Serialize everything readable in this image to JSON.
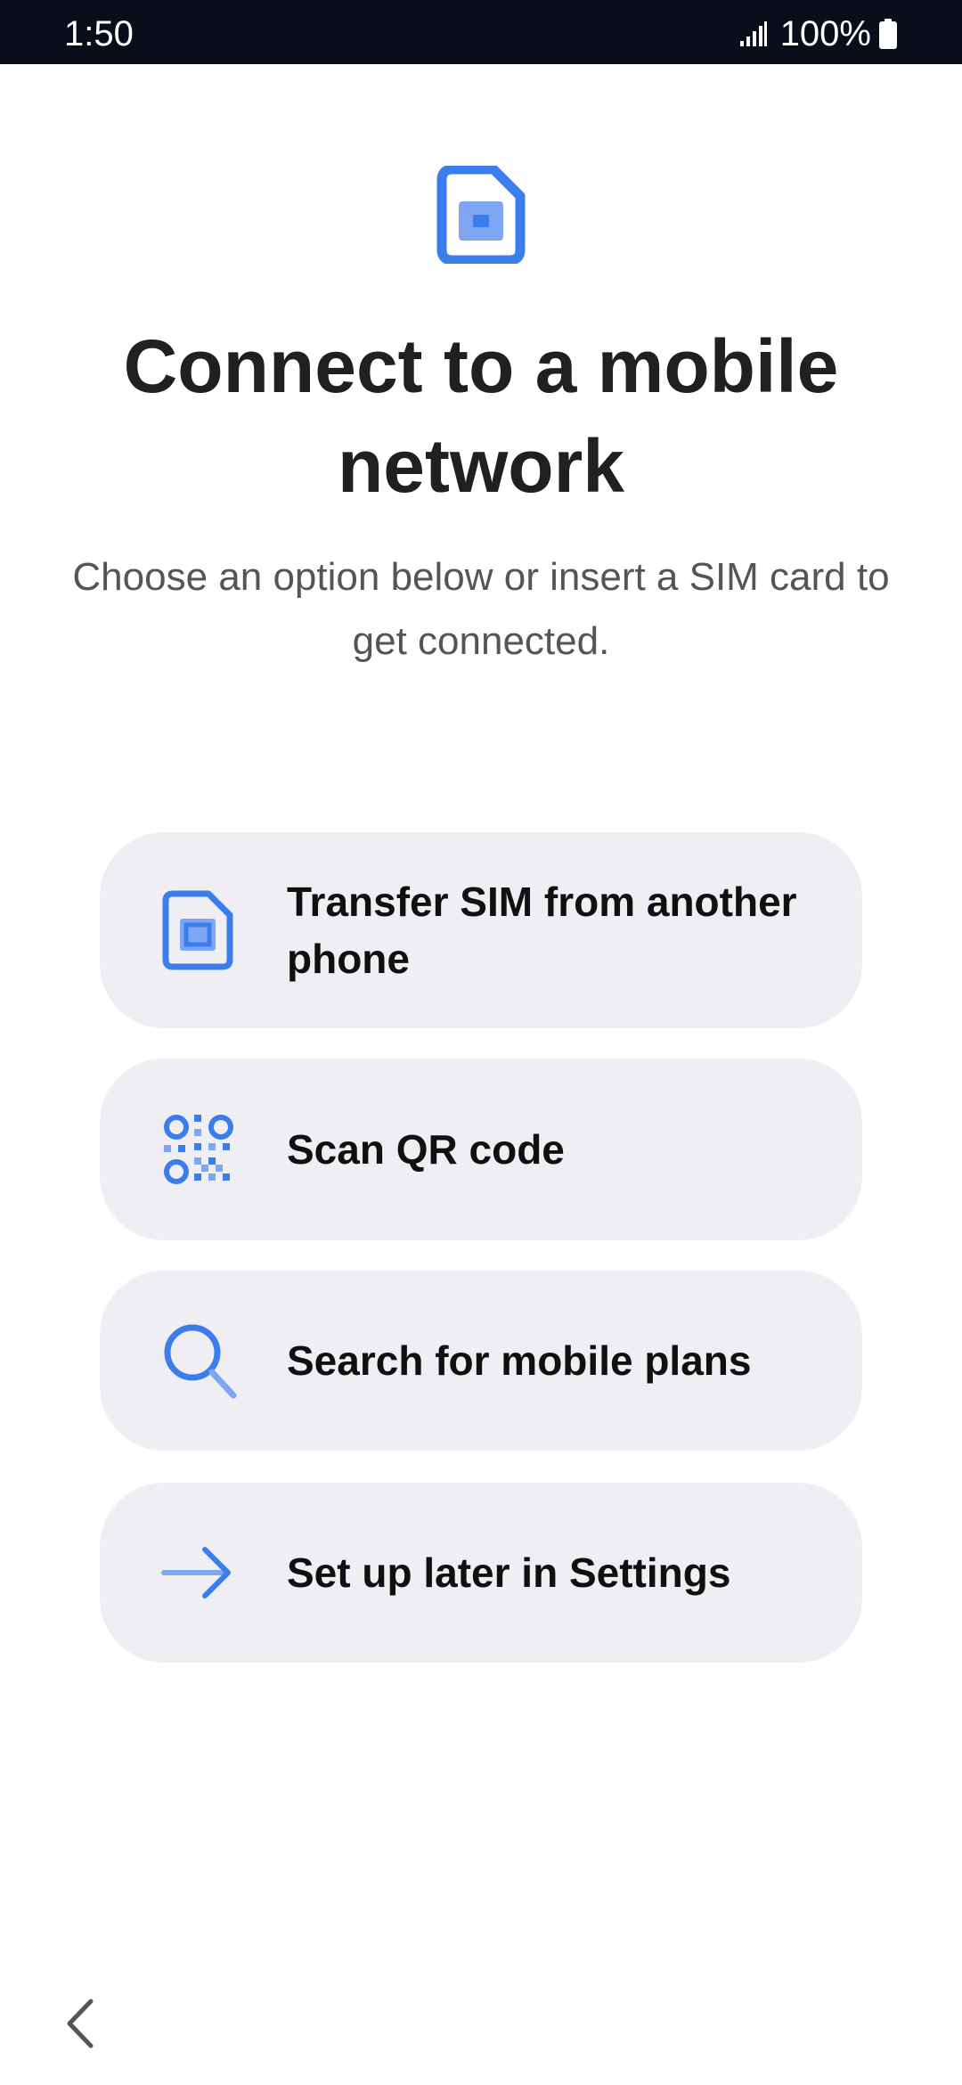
{
  "status_bar": {
    "time": "1:50",
    "battery": "100%",
    "icons": [
      "signal-icon",
      "battery-icon"
    ]
  },
  "header": {
    "icon": "sim-card-icon",
    "title": "Connect to a mobile network",
    "subtitle": "Choose an option below or insert a SIM card to get connected."
  },
  "options": [
    {
      "label": "Transfer SIM from another phone",
      "icon": "sim-card-icon"
    },
    {
      "label": "Scan QR code",
      "icon": "qr-code-icon"
    },
    {
      "label": "Search for mobile plans",
      "icon": "search-icon"
    },
    {
      "label": "Set up later in Settings",
      "icon": "arrow-right-icon"
    }
  ],
  "navigation": {
    "back_icon": "chevron-left-icon"
  },
  "colors": {
    "accent": "#3b7ded",
    "accent_light": "#7ea6f2",
    "option_background": "#efeff3",
    "status_bar": "#0a0e1a"
  }
}
